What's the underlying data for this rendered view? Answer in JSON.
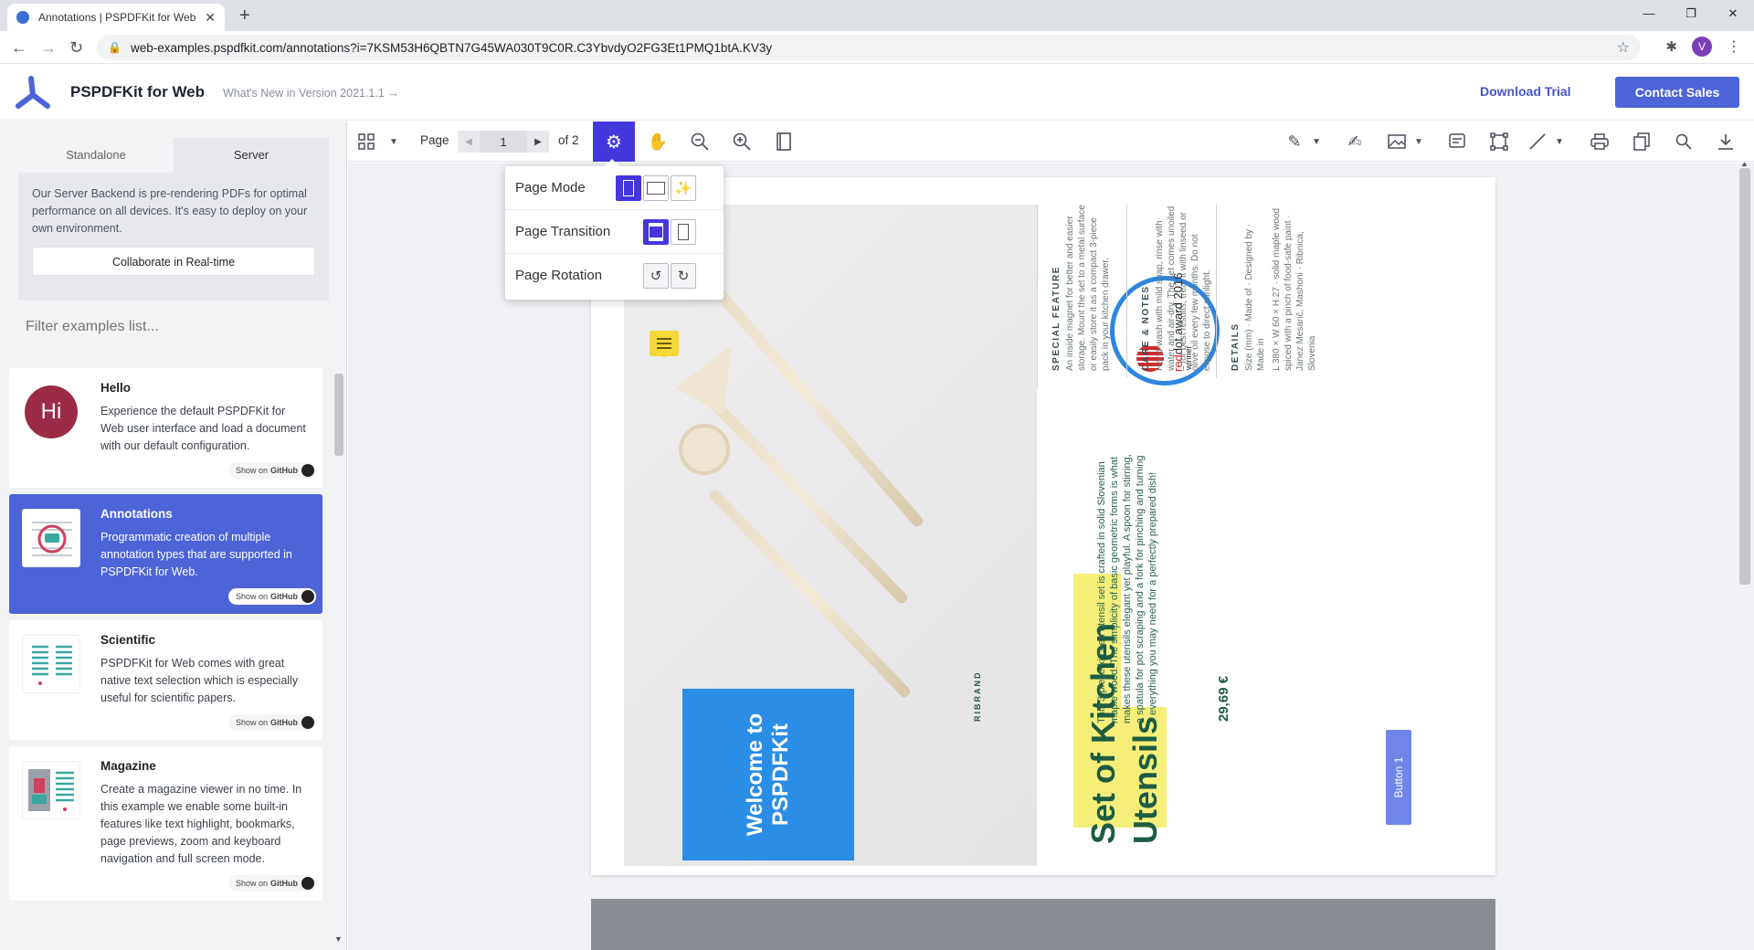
{
  "browser": {
    "tab_title": "Annotations | PSPDFKit for Web",
    "url": "web-examples.pspdfkit.com/annotations?i=7KSM53H6QBTN7G45WA030T9C0R.C3YbvdyO2FG3Et1PMQ1btA.KV3y",
    "profile_initial": "V"
  },
  "header": {
    "brand": "PSPDFKit for Web",
    "whats_new": "What's New in Version 2021.1.1 →",
    "download_trial": "Download Trial",
    "contact_sales": "Contact Sales"
  },
  "sidebar": {
    "tabs": [
      "Standalone",
      "Server"
    ],
    "active_tab": "Server",
    "server_description": "Our Server Backend is pre-rendering PDFs for optimal performance on all devices. It's easy to deploy on your own environment.",
    "collaborate_label": "Collaborate in Real-time",
    "filter_placeholder": "Filter examples list...",
    "github_prefix": "Show on",
    "github_label": "GitHub",
    "examples": [
      {
        "title": "Hello",
        "description": "Experience the default PSPDFKit for Web user interface and load a document with our default configuration.",
        "thumb_text": "Hi",
        "selected": false
      },
      {
        "title": "Annotations",
        "description": "Programmatic creation of multiple annotation types that are supported in PSPDFKit for Web.",
        "selected": true
      },
      {
        "title": "Scientific",
        "description": "PSPDFKit for Web comes with great native text selection which is especially useful for scientific papers.",
        "selected": false
      },
      {
        "title": "Magazine",
        "description": "Create a magazine viewer in no time. In this example we enable some built-in features like text highlight, bookmarks, page previews, zoom and keyboard navigation and full screen mode.",
        "selected": false
      }
    ]
  },
  "toolbar": {
    "page_label": "Page",
    "current_page": "1",
    "of_pages": "of 2"
  },
  "settings_popover": {
    "page_mode": "Page Mode",
    "page_transition": "Page Transition",
    "page_rotation": "Page Rotation"
  },
  "document": {
    "welcome_line1": "Welcome to",
    "welcome_line2": "PSPDFKit",
    "award_brand_a": "red",
    "award_brand_b": "dot",
    "award_year": " award 2016",
    "award_sub": "winner",
    "special_feature_title": "SPECIAL FEATURE",
    "special_feature_body": "An inside magnet for better and easier storage. Mount the set to a metal surface or easily store it as a compact 3-piece pack in your kitchen drawer.",
    "care_title": "CARE & NOTES",
    "care_body": "Hand-wash with mild soap, rinse with water and air-dry. The set comes unoiled – for best results, treat it with linseed or olive oil every few months. Do not expose to direct sunlight.",
    "details_title": "DETAILS",
    "details_labels": "Size (mm) · Made of · Designed by · Made in",
    "details_values": "L 380 × W 60 × H 27 · solid maple wood spiced with a pinch of food-safe paint · Janez Mesarič, Mashoni · Ribnica, Slovenia",
    "ribrand": "RIBRAND",
    "title_line1": "Set of Kitchen",
    "title_line2": "Utensils",
    "description": "This 3-piece kitchen utensil set is crafted in solid Slovenian maple wood. The simplicity of basic geometric forms is what makes these utensils elegant yet playful. A spoon for stirring, a spatula for pot scraping and a fork for pinching and turning – everything you may need for a perfectly prepared dish!",
    "price": "29,69 €",
    "button_label": "Button 1"
  },
  "colors": {
    "accent": "#4537de",
    "primary_button": "#4c64d8",
    "selected_card": "#4c64d8",
    "welcome_box": "#2a8de6",
    "title_highlight": "#f5ef7a",
    "title_text": "#1d5c42"
  }
}
